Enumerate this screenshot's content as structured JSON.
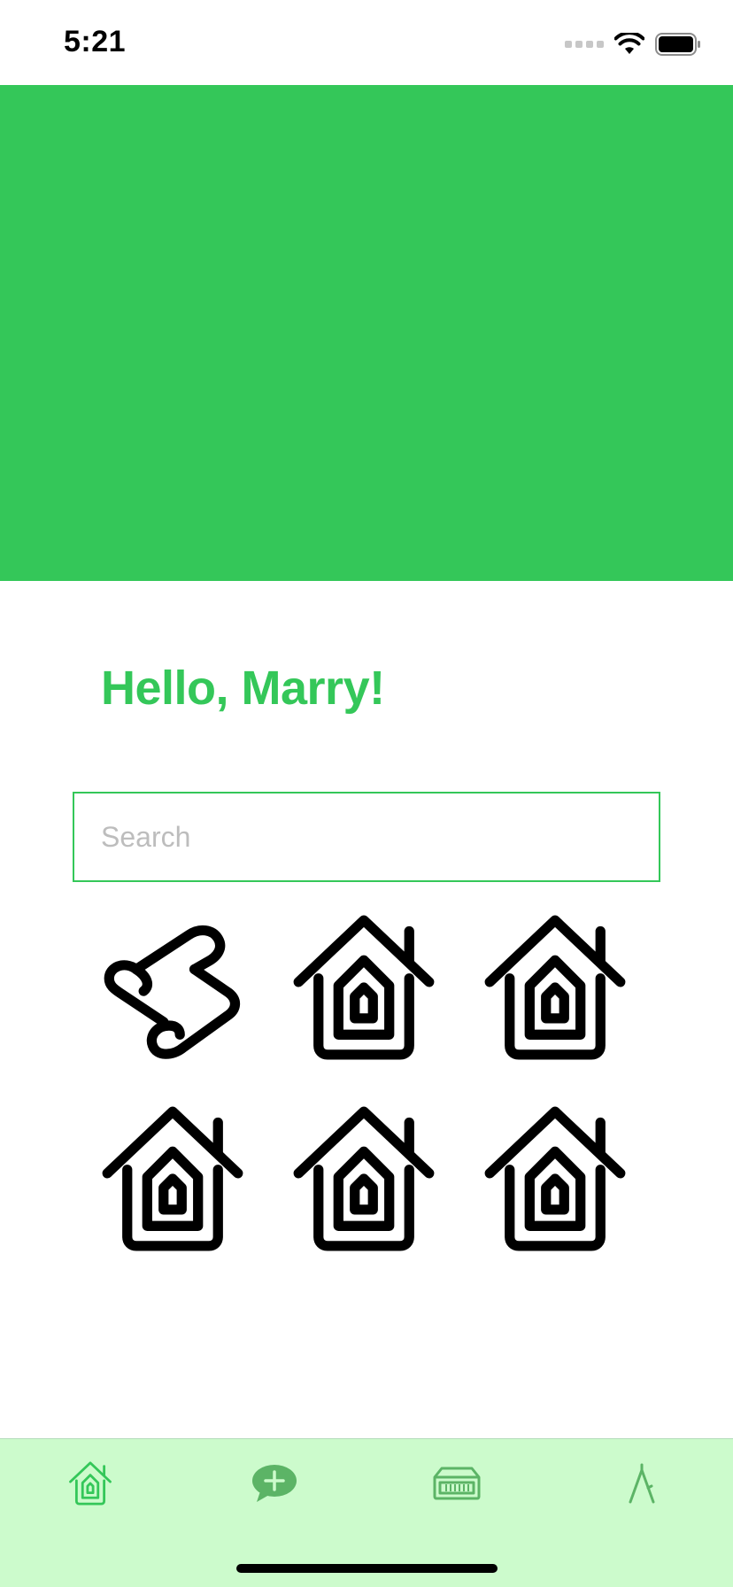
{
  "status_bar": {
    "time": "5:21",
    "icons": [
      "signal-icon",
      "wifi-icon",
      "battery-icon"
    ]
  },
  "colors": {
    "accent": "#34C759",
    "tab_bar_background": "#CCFBCC",
    "icon": "#000000"
  },
  "hero": {
    "background": "#34C759"
  },
  "greeting": {
    "text": "Hello, Marry!"
  },
  "search": {
    "value": "",
    "placeholder": "Search"
  },
  "grid": {
    "items": [
      {
        "icon": "scroll-icon"
      },
      {
        "icon": "homekit-icon"
      },
      {
        "icon": "homekit-icon"
      },
      {
        "icon": "homekit-icon"
      },
      {
        "icon": "homekit-icon"
      },
      {
        "icon": "homekit-icon"
      }
    ]
  },
  "tab_bar": {
    "items": [
      {
        "icon": "homekit-icon",
        "selected": true
      },
      {
        "icon": "add-message-icon",
        "selected": false
      },
      {
        "icon": "building-icon",
        "selected": false
      },
      {
        "icon": "compass-drawing-icon",
        "selected": false
      }
    ]
  }
}
